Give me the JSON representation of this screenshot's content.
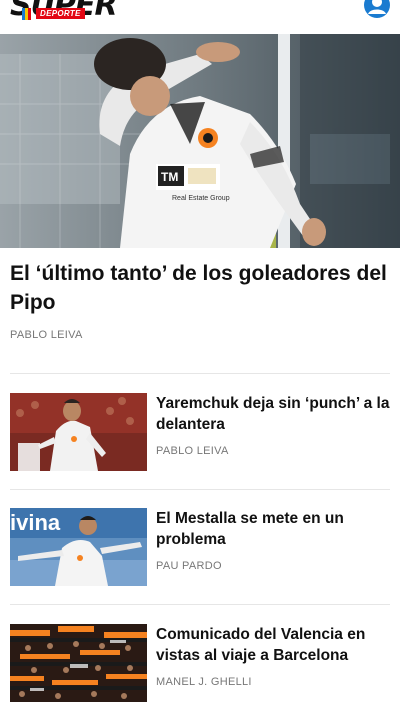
{
  "header": {
    "logo_text": "SUPER",
    "logo_sub": "DEPORTE",
    "account_icon": "user-account-icon"
  },
  "main_story": {
    "title": "El ‘último tanto’ de los goleadores del Pipo",
    "author": "PABLO LEIVA",
    "image_shirt_text": "TM",
    "image_shirt_sub": "Real Estate Group"
  },
  "stories": [
    {
      "title": "Yaremchuk deja sin ‘punch’ a la delantera",
      "author": "PABLO LEIVA"
    },
    {
      "title": "El Mestalla se mete en un problema",
      "author": "PAU PARDO",
      "image_banner_text": "ivina"
    },
    {
      "title": "Comunicado del Valencia en vistas al viaje a Barcelona",
      "author": "MANEL J. GHELLI"
    }
  ],
  "colors": {
    "brand_red": "#e30613",
    "accent_blue": "#1a7bd0",
    "valencia_orange": "#f58220"
  }
}
